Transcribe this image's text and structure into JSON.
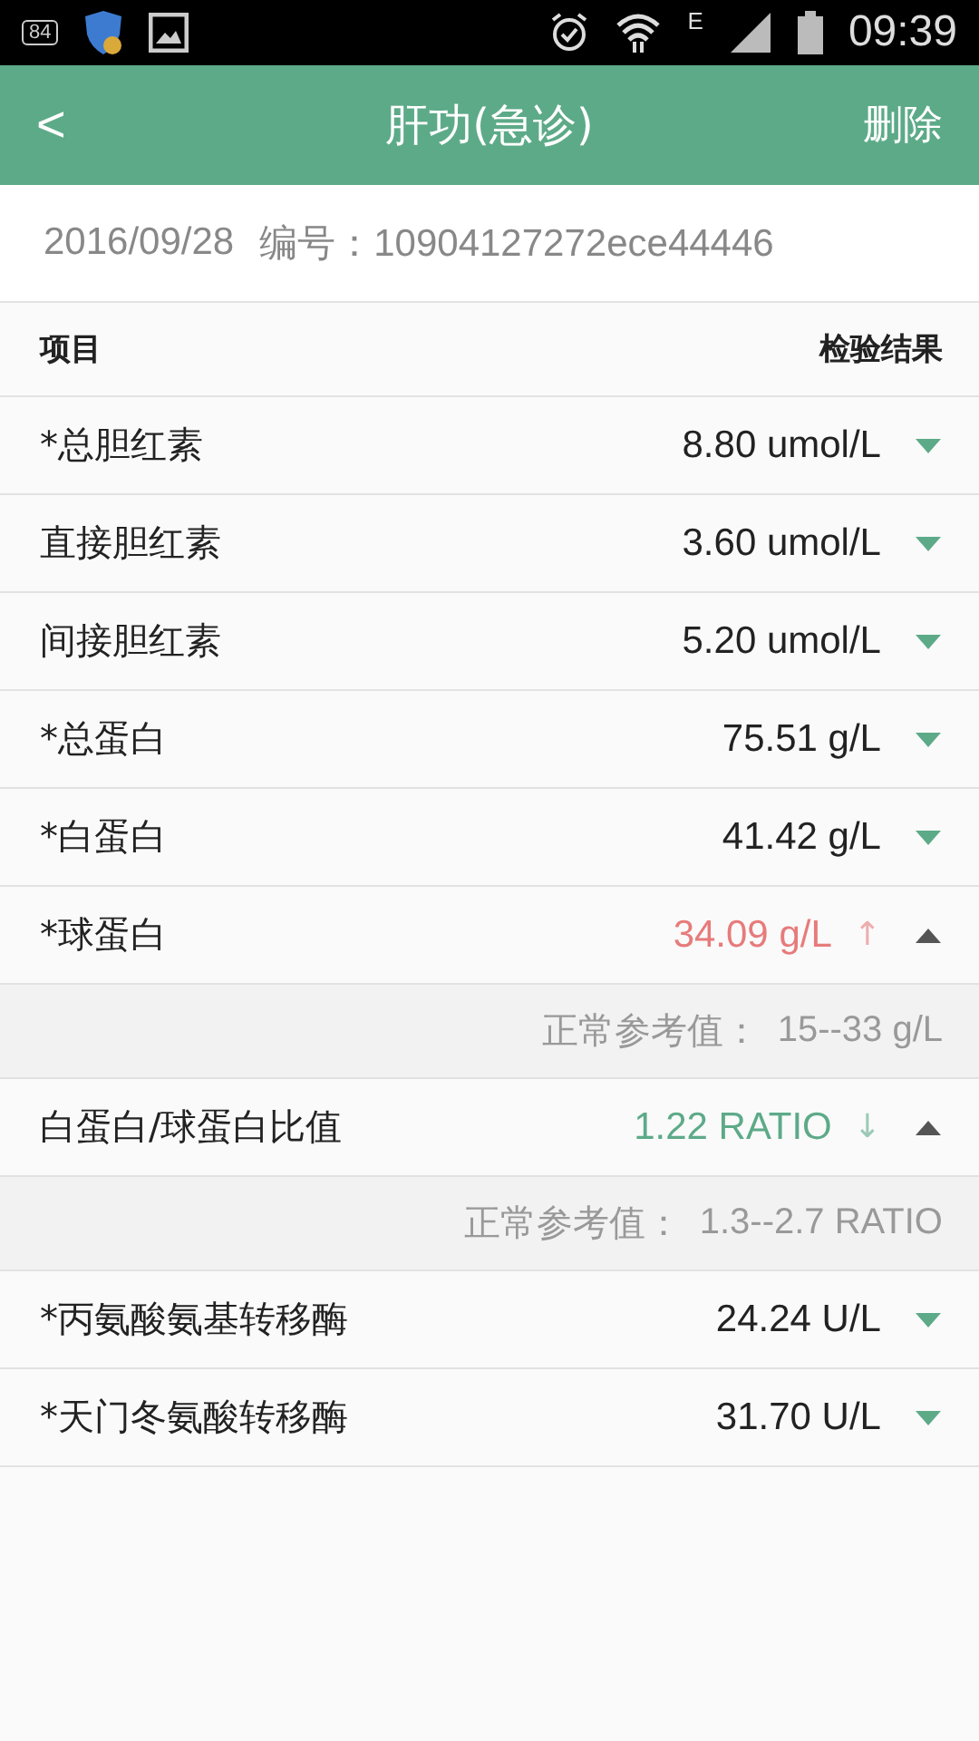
{
  "status_bar": {
    "badge": "84",
    "network": "E",
    "time": "09:39"
  },
  "header": {
    "back": "<",
    "title": "肝功(急诊)",
    "action": "删除"
  },
  "info": {
    "date": "2016/09/28",
    "number_label": "编号：",
    "number": "10904127272ece44446"
  },
  "table": {
    "columns": [
      "项目",
      "检验结果"
    ],
    "rows": [
      {
        "name": "*总胆红素",
        "value": "8.80 umol/L",
        "kind": "normal",
        "expanded": false
      },
      {
        "name": "直接胆红素",
        "value": "3.60 umol/L",
        "kind": "normal",
        "expanded": false
      },
      {
        "name": "间接胆红素",
        "value": "5.20 umol/L",
        "kind": "normal",
        "expanded": false
      },
      {
        "name": "*总蛋白",
        "value": "75.51 g/L",
        "kind": "normal",
        "expanded": false
      },
      {
        "name": "*白蛋白",
        "value": "41.42 g/L",
        "kind": "normal",
        "expanded": false
      },
      {
        "name": "*球蛋白",
        "value": "34.09 g/L",
        "kind": "high",
        "flag": "↑",
        "expanded": true,
        "reference_label": "正常参考值：",
        "reference": "15--33 g/L"
      },
      {
        "name": "白蛋白/球蛋白比值",
        "value": "1.22 RATIO",
        "kind": "low",
        "flag": "↓",
        "expanded": true,
        "reference_label": "正常参考值：",
        "reference": "1.3--2.7 RATIO"
      },
      {
        "name": "*丙氨酸氨基转移酶",
        "value": "24.24 U/L",
        "kind": "normal",
        "expanded": false
      },
      {
        "name": "*天门冬氨酸转移酶",
        "value": "31.70 U/L",
        "kind": "normal",
        "expanded": false
      }
    ]
  }
}
